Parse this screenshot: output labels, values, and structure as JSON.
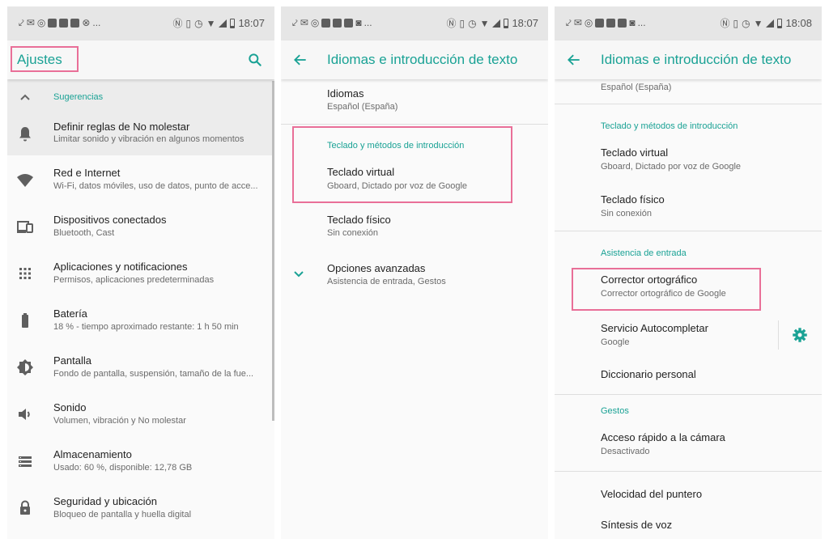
{
  "colors": {
    "accent": "#1aa295",
    "highlight": "#e96f98"
  },
  "status": {
    "time1": "18:07",
    "time2": "18:07",
    "time3": "18:08",
    "ellipsis": "..."
  },
  "p1": {
    "title": "Ajustes",
    "suggestions": "Sugerencias",
    "items": [
      {
        "title": "Definir reglas de No molestar",
        "sub": "Limitar sonido y vibración en algunos momentos",
        "icon": "bell-icon"
      },
      {
        "title": "Red e Internet",
        "sub": "Wi-Fi, datos móviles, uso de datos, punto de acce...",
        "icon": "wifi-icon"
      },
      {
        "title": "Dispositivos conectados",
        "sub": "Bluetooth, Cast",
        "icon": "devices-icon"
      },
      {
        "title": "Aplicaciones y notificaciones",
        "sub": "Permisos, aplicaciones predeterminadas",
        "icon": "apps-grid-icon"
      },
      {
        "title": "Batería",
        "sub": "18 % - tiempo aproximado restante: 1 h 50 min",
        "icon": "battery-icon"
      },
      {
        "title": "Pantalla",
        "sub": "Fondo de pantalla, suspensión, tamaño de la fue...",
        "icon": "brightness-icon"
      },
      {
        "title": "Sonido",
        "sub": "Volumen, vibración y No molestar",
        "icon": "volume-icon"
      },
      {
        "title": "Almacenamiento",
        "sub": "Usado: 60 %, disponible: 12,78 GB",
        "icon": "storage-icon"
      },
      {
        "title": "Seguridad y ubicación",
        "sub": "Bloqueo de pantalla y huella digital",
        "icon": "lock-icon"
      }
    ]
  },
  "p2": {
    "title": "Idiomas e introducción de texto",
    "languages_title": "Idiomas",
    "languages_sub": "Español (España)",
    "keyboard_header": "Teclado y métodos de introducción",
    "virtual_title": "Teclado virtual",
    "virtual_sub": "Gboard, Dictado por voz de Google",
    "physical_title": "Teclado físico",
    "physical_sub": "Sin conexión",
    "advanced_title": "Opciones avanzadas",
    "advanced_sub": "Asistencia de entrada, Gestos"
  },
  "p3": {
    "title": "Idiomas e introducción de texto",
    "top_sub": "Español (España)",
    "keyboard_header": "Teclado y métodos de introducción",
    "virtual_title": "Teclado virtual",
    "virtual_sub": "Gboard, Dictado por voz de Google",
    "physical_title": "Teclado físico",
    "physical_sub": "Sin conexión",
    "input_header": "Asistencia de entrada",
    "spell_title": "Corrector ortográfico",
    "spell_sub": "Corrector ortográfico de Google",
    "autofill_title": "Servicio Autocompletar",
    "autofill_sub": "Google",
    "dictionary_title": "Diccionario personal",
    "gestures_header": "Gestos",
    "camera_title": "Acceso rápido a la cámara",
    "camera_sub": "Desactivado",
    "pointer_title": "Velocidad del puntero",
    "tts_title": "Síntesis de voz"
  }
}
